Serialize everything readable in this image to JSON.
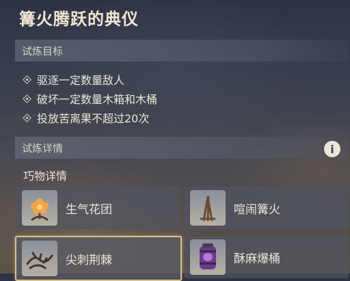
{
  "title": "篝火腾跃的典仪",
  "objectives_section": {
    "label": "试炼目标",
    "items": [
      "驱逐一定数量敌人",
      "破坏一定数量木箱和木桶",
      "投放苦离果不超过20次"
    ]
  },
  "details_section": {
    "label": "试炼详情",
    "info_icon": "info-icon"
  },
  "gadgets": {
    "label": "巧物详情",
    "items": [
      {
        "name": "生气花团",
        "icon": "flower-cluster-icon",
        "selected": false
      },
      {
        "name": "喧闹篝火",
        "icon": "bonfire-sticks-icon",
        "selected": false
      },
      {
        "name": "尖刺荆棘",
        "icon": "thorn-bramble-icon",
        "selected": true
      },
      {
        "name": "酥麻爆桶",
        "icon": "purple-barrel-icon",
        "selected": false
      }
    ]
  },
  "colors": {
    "accent_border": "#d9c28e",
    "text": "#ece5d8"
  }
}
